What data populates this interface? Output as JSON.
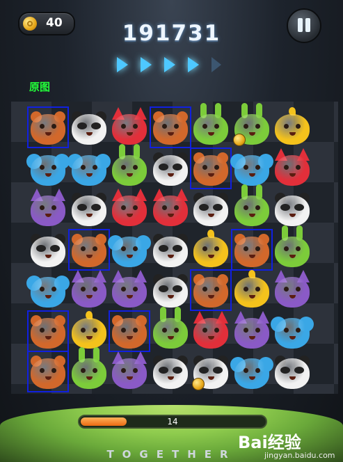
{
  "coins": "40",
  "score": "191731",
  "arrows": [
    "on",
    "on",
    "on",
    "on",
    "off"
  ],
  "caption": "原图",
  "moves_left": "14",
  "progress": 0.25,
  "brand": "TOGETHER",
  "watermark": "Bai经验",
  "watermark_url": "jingyan.baidu.com",
  "animal_colors": {
    "bear": "#d2682b",
    "panda": "#f2f2f2",
    "fox": "#e22f3a",
    "bunny": "#7ccc3a",
    "chick": "#f4c21c",
    "mouse": "#3aa7e6",
    "cat": "#8a5ac6"
  },
  "grid": [
    [
      "bear",
      "panda",
      "fox",
      "bear",
      "bunny",
      "bunny",
      "chick"
    ],
    [
      "mouse",
      "mouse",
      "bunny",
      "panda",
      "bear",
      "mouse",
      "fox"
    ],
    [
      "cat",
      "panda",
      "fox",
      "fox",
      "panda",
      "bunny",
      "panda"
    ],
    [
      "panda",
      "bear",
      "mouse",
      "panda",
      "chick",
      "bear",
      "bunny"
    ],
    [
      "mouse",
      "cat",
      "cat",
      "panda",
      "bear",
      "chick",
      "cat"
    ],
    [
      "bear",
      "chick",
      "bear",
      "bunny",
      "fox",
      "cat",
      "mouse"
    ],
    [
      "bear",
      "bunny",
      "cat",
      "panda",
      "panda",
      "mouse",
      "panda"
    ]
  ],
  "highlights": [
    [
      0,
      0
    ],
    [
      0,
      3
    ],
    [
      1,
      4
    ],
    [
      3,
      1
    ],
    [
      3,
      5
    ],
    [
      4,
      4
    ],
    [
      5,
      0
    ],
    [
      5,
      2
    ],
    [
      6,
      0
    ]
  ],
  "coin_tokens": [
    [
      0,
      5
    ],
    [
      6,
      4
    ]
  ]
}
